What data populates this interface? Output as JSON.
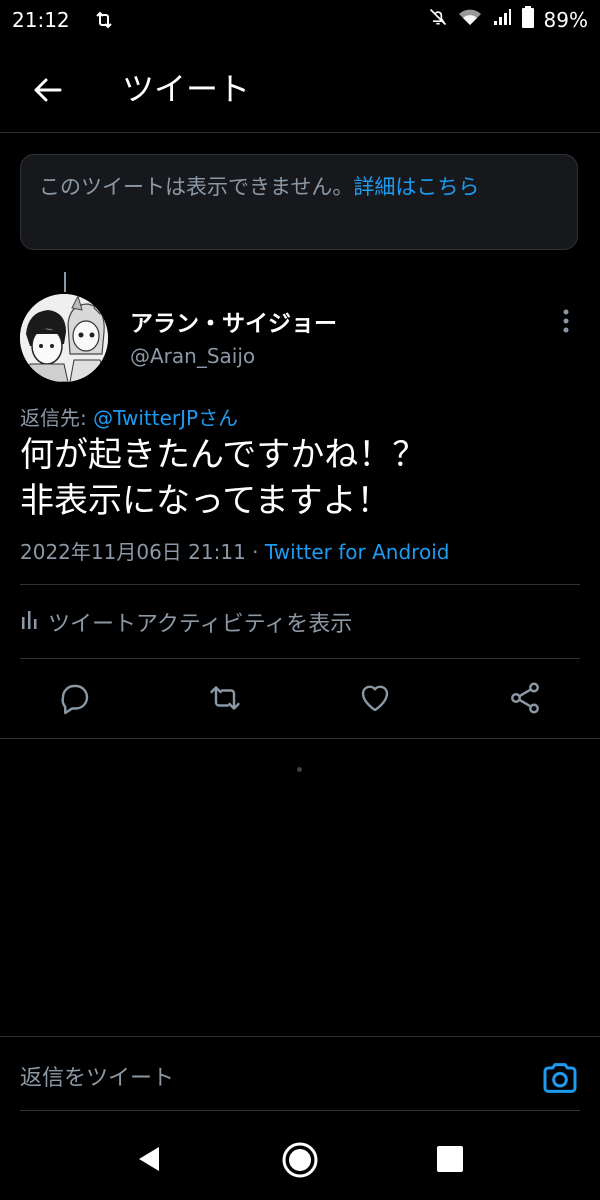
{
  "status_bar": {
    "time": "21:12",
    "battery": "89%"
  },
  "header": {
    "title": "ツイート"
  },
  "notice": {
    "text": "このツイートは表示できません。",
    "link": "詳細はこちら"
  },
  "tweet": {
    "user_name": "アラン・サイジョー",
    "handle": "@Aran_Saijo",
    "reply_label": "返信先: ",
    "reply_mention": "@TwitterJPさん",
    "text_line1": "何が起きたんですかね！？",
    "text_line2": "非表示になってますよ！",
    "timestamp": "2022年11月06日 21:11 · ",
    "source": "Twitter for Android",
    "activity_label": "ツイートアクティビティを表示"
  },
  "composer": {
    "placeholder": "返信をツイート"
  },
  "colors": {
    "accent": "#1d9bf0",
    "background": "#000000",
    "muted": "#8b98a5"
  }
}
